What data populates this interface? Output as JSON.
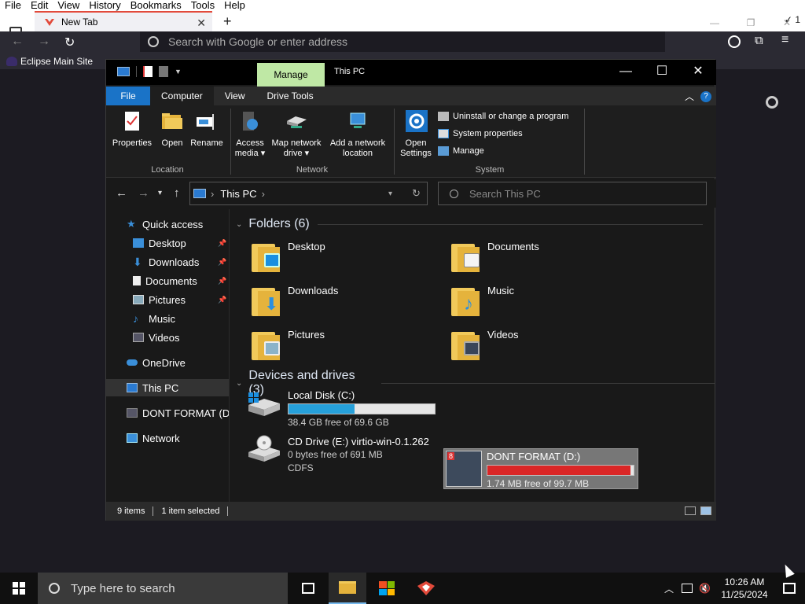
{
  "firefox": {
    "menu": [
      "File",
      "Edit",
      "View",
      "History",
      "Bookmarks",
      "Tools",
      "Help"
    ],
    "tab_title": "New Tab",
    "new_tab": "+",
    "address_placeholder": "Search with Google or enter address",
    "bookmark": "Eclipse Main Site",
    "sync_count": "1",
    "accent": "#e24a3b"
  },
  "explorer": {
    "context_tab": "Manage",
    "title": "This PC",
    "ribbon_tabs": [
      "File",
      "Computer",
      "View",
      "Drive Tools"
    ],
    "groups": {
      "location": "Location",
      "network": "Network",
      "system": "System"
    },
    "buttons": {
      "properties": "Properties",
      "open": "Open",
      "rename": "Rename",
      "access_media_1": "Access",
      "access_media_2": "media ▾",
      "map_drive_1": "Map network",
      "map_drive_2": "drive ▾",
      "add_location_1": "Add a network",
      "add_location_2": "location",
      "open_settings_1": "Open",
      "open_settings_2": "Settings",
      "uninstall": "Uninstall or change a program",
      "system_properties": "System properties",
      "manage": "Manage"
    },
    "address": "This PC",
    "search_placeholder": "Search This PC",
    "nav": {
      "quick_access": "Quick access",
      "desktop": "Desktop",
      "downloads": "Downloads",
      "documents": "Documents",
      "pictures": "Pictures",
      "music": "Music",
      "videos": "Videos",
      "onedrive": "OneDrive",
      "this_pc": "This PC",
      "dont_format": "DONT FORMAT (D",
      "network": "Network"
    },
    "folders_header": "Folders (6)",
    "folders": {
      "desktop": "Desktop",
      "documents": "Documents",
      "downloads": "Downloads",
      "music": "Music",
      "pictures": "Pictures",
      "videos": "Videos"
    },
    "devices_header": "Devices and drives (3)",
    "drives": {
      "c_name": "Local Disk (C:)",
      "c_free": "38.4 GB free of 69.6 GB",
      "c_used_fraction": 0.45,
      "d_name": "DONT FORMAT (D:)",
      "d_free": "1.74 MB free of 99.7 MB",
      "d_used_fraction": 0.98,
      "e_name": "CD Drive (E:) virtio-win-0.1.262",
      "e_free": "0 bytes free of 691 MB",
      "e_fs": "CDFS"
    },
    "status": {
      "items": "9 items",
      "selected": "1 item selected"
    },
    "colors": {
      "manage_tab": "#bfe8a5",
      "file_tab": "#1a73c7",
      "bar_normal": "#26a0da",
      "bar_full": "#da2626"
    }
  },
  "taskbar": {
    "search_placeholder": "Type here to search",
    "time": "10:26 AM",
    "date": "11/25/2024"
  }
}
